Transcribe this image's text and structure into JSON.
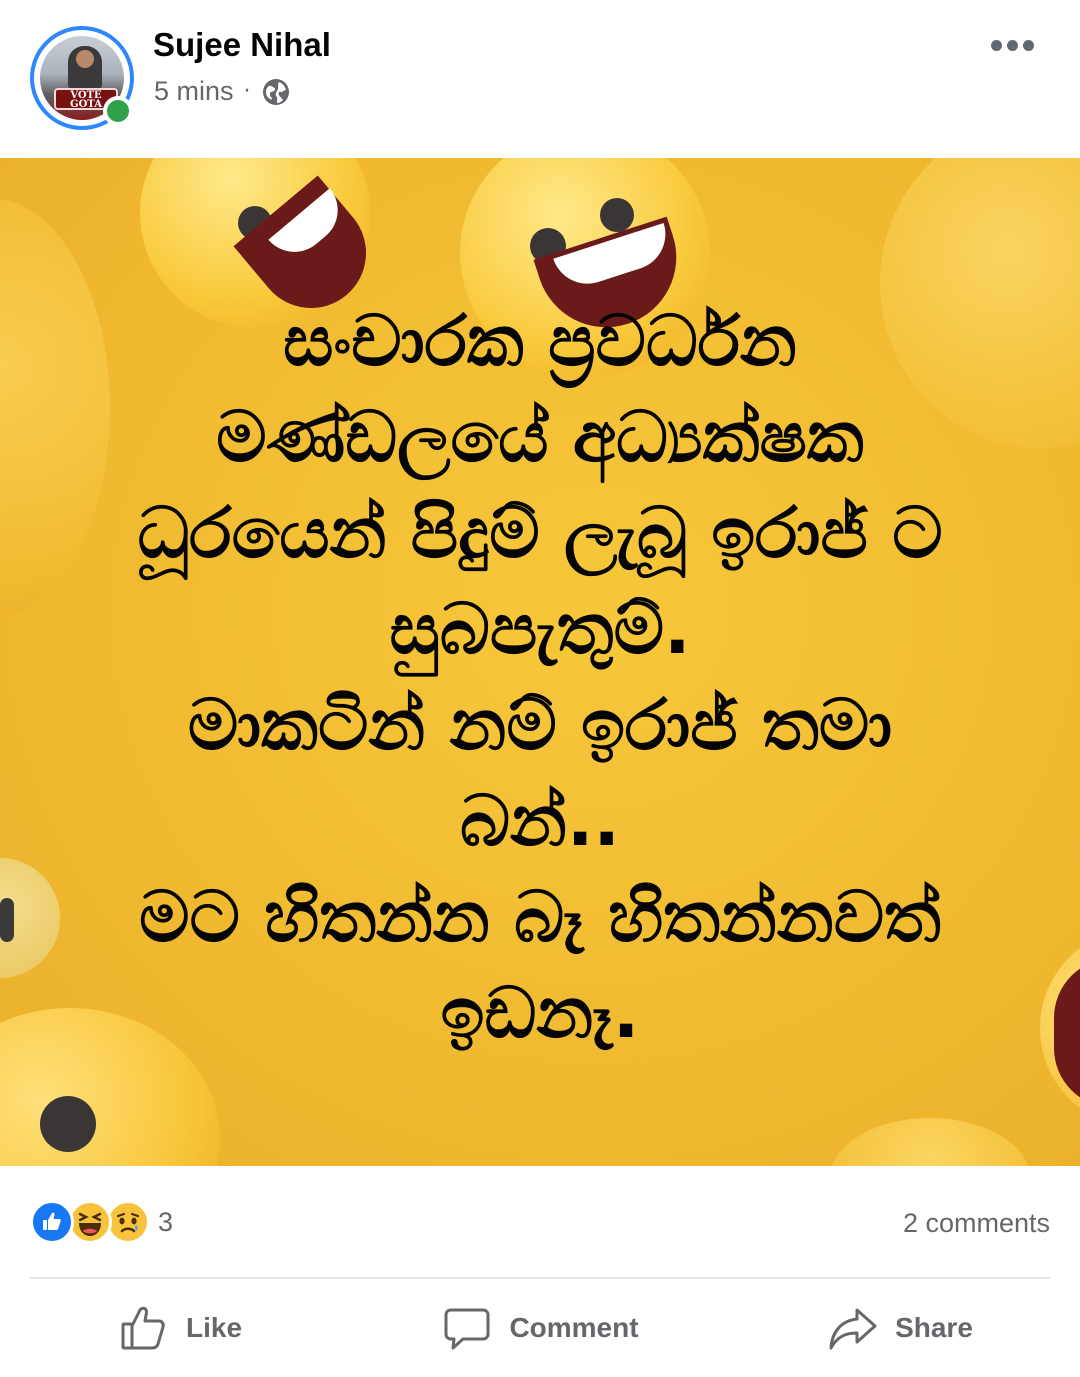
{
  "post": {
    "author": "Sujee Nihal",
    "time": "5 mins",
    "separator": "·",
    "avatar_badge": "VOTE GOTA",
    "privacy_icon": "globe-icon",
    "more_icon": "more-horizontal-icon"
  },
  "image_text": [
    "සංචාරක ප්‍රවර්ධන",
    "මණ්ඩලයේ අධ්‍යක්ෂක",
    "ධූරයෙන් පිදුම් ලැබූ ඉරාජ් ට",
    "සුබපැතුම්.",
    "මාකටින් නම් ඉරාජ් තමා",
    "බන්..",
    "මට හිතන්න බෑ හිතන්නවත්",
    "ඉඩනෑ."
  ],
  "reactions": {
    "types": [
      "like",
      "haha",
      "sad"
    ],
    "count": "3",
    "comments": "2 comments"
  },
  "actions": {
    "like": "Like",
    "comment": "Comment",
    "share": "Share"
  },
  "colors": {
    "like_blue": "#1877f2",
    "image_background": "#f1bb31",
    "online_green": "#31a24c",
    "secondary_text": "#65676b"
  }
}
